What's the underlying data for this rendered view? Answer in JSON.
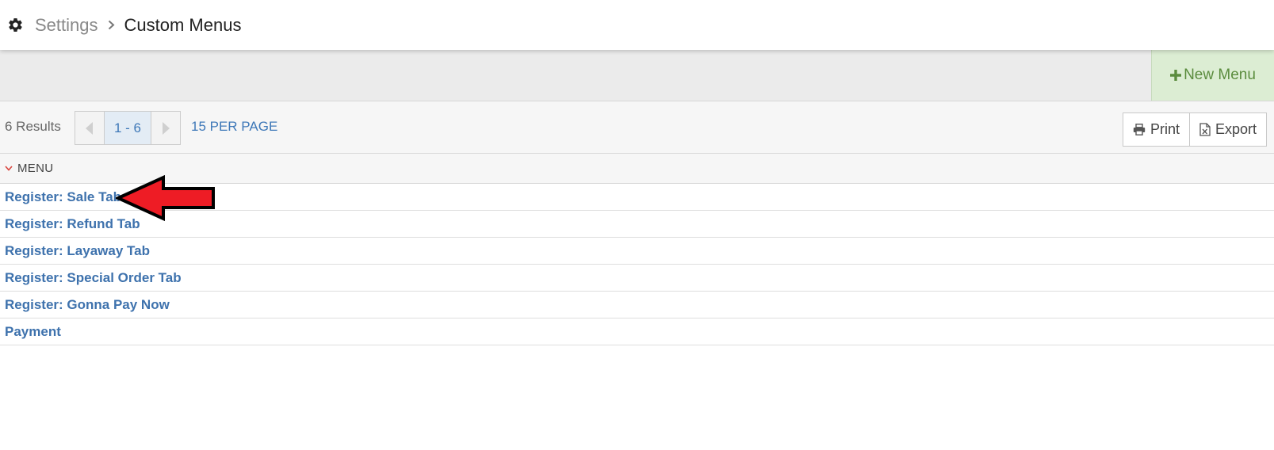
{
  "header": {
    "icon": "gear-icon",
    "breadcrumb_parent": "Settings",
    "separator_icon": "chevron-right-icon",
    "title": "Custom Menus"
  },
  "toolbar": {
    "new_menu_label": "New Menu",
    "new_menu_icon": "plus-icon",
    "new_menu_color": "#5b8c3e"
  },
  "pagination": {
    "results_text": "6 Results",
    "range": "1 - 6",
    "per_page": "15 PER PAGE",
    "prev_icon": "caret-left-icon",
    "next_icon": "caret-right-icon"
  },
  "actions": {
    "print_label": "Print",
    "print_icon": "printer-icon",
    "export_label": "Export",
    "export_icon": "excel-file-icon"
  },
  "table": {
    "column_header": "MENU",
    "sort_icon": "chevron-down-icon",
    "rows": [
      "Register: Sale Tab",
      "Register: Refund Tab",
      "Register: Layaway Tab",
      "Register: Special Order Tab",
      "Register: Gonna Pay Now",
      "Payment"
    ]
  },
  "annotation": {
    "icon": "red-arrow-icon",
    "color": "#ee1c25"
  }
}
